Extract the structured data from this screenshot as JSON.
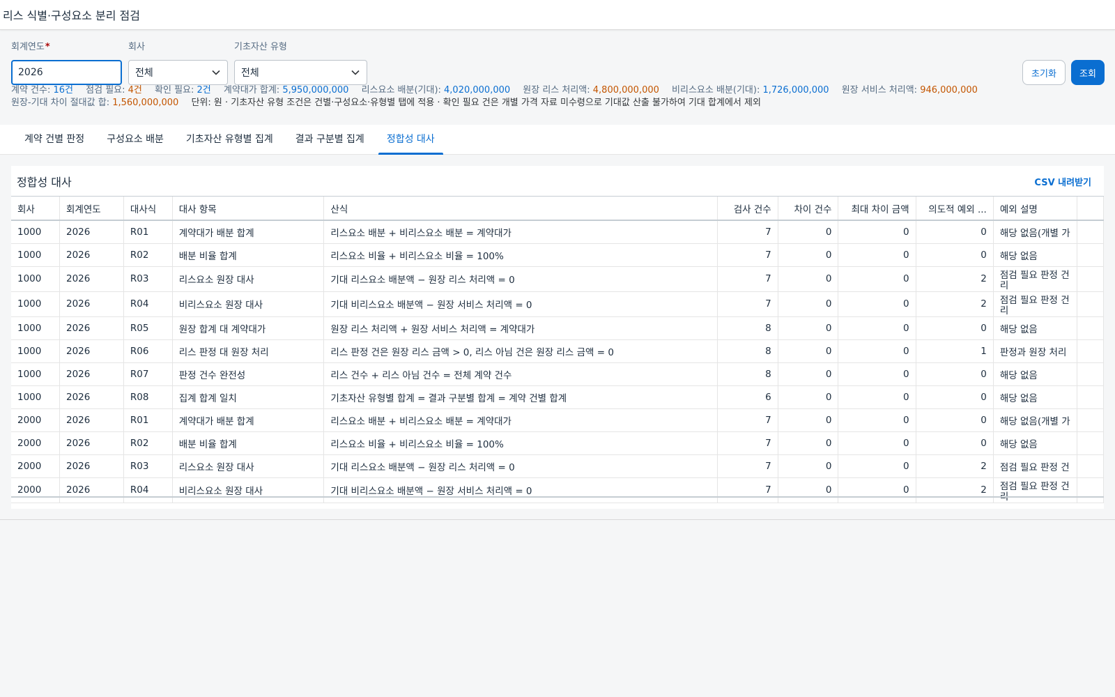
{
  "header": {
    "title": "리스 식별·구성요소 분리 점검"
  },
  "filters": {
    "fiscal_year": {
      "label": "회계연도",
      "required_mark": "*",
      "value": "2026"
    },
    "company": {
      "label": "회사",
      "value": "전체"
    },
    "asset_type": {
      "label": "기초자산 유형",
      "value": "전체"
    }
  },
  "buttons": {
    "reset": "초기화",
    "search": "조회"
  },
  "stats": {
    "contract_count": {
      "label": "계약 건수: ",
      "value": "16건"
    },
    "check_needed": {
      "label": "점검 필요: ",
      "value": "4건"
    },
    "confirm_needed": {
      "label": "확인 필요: ",
      "value": "2건"
    },
    "contract_total": {
      "label": "계약대가 합계: ",
      "value": "5,950,000,000"
    },
    "lease_alloc": {
      "label": "리스요소 배분(기대): ",
      "value": "4,020,000,000"
    },
    "ledger_lease": {
      "label": "원장 리스 처리액: ",
      "value": "4,800,000,000"
    },
    "nonlease_alloc": {
      "label": "비리스요소 배분(기대): ",
      "value": "1,726,000,000"
    },
    "ledger_service": {
      "label": "원장 서비스 처리액: ",
      "value": "946,000,000"
    },
    "abs_diff": {
      "label": "원장-기대 차이 절대값 합: ",
      "value": "1,560,000,000"
    },
    "note": "단위: 원 · 기초자산 유형 조건은 건별·구성요소·유형별 탭에 적용 · 확인 필요 건은 개별 가격 자료 미수령으로 기대값 산출 불가하여 기대 합계에서 제외"
  },
  "tabs": [
    {
      "label": "계약 건별 판정"
    },
    {
      "label": "구성요소 배분"
    },
    {
      "label": "기초자산 유형별 집계"
    },
    {
      "label": "결과 구분별 집계"
    },
    {
      "label": "정합성 대사"
    }
  ],
  "panel": {
    "title": "정합성 대사",
    "csv": "CSV 내려받기"
  },
  "table": {
    "columns": [
      "회사",
      "회계연도",
      "대사식",
      "대사 항목",
      "산식",
      "검사 건수",
      "차이 건수",
      "최대 차이 금액",
      "의도적 예외 ...",
      "예외 설명"
    ],
    "rows": [
      [
        "1000",
        "2026",
        "R01",
        "계약대가 배분 합계",
        "리스요소 배분 + 비리스요소 배분 = 계약대가",
        "7",
        "0",
        "0",
        "0",
        "해당 없음(개별 가"
      ],
      [
        "1000",
        "2026",
        "R02",
        "배분 비율 합계",
        "리스요소 비율 + 비리스요소 비율 = 100%",
        "7",
        "0",
        "0",
        "0",
        "해당 없음"
      ],
      [
        "1000",
        "2026",
        "R03",
        "리스요소 원장 대사",
        "기대 리스요소 배분액 − 원장 리스 처리액 = 0",
        "7",
        "0",
        "0",
        "2",
        "점검 필요 판정 건 리"
      ],
      [
        "1000",
        "2026",
        "R04",
        "비리스요소 원장 대사",
        "기대 비리스요소 배분액 − 원장 서비스 처리액 = 0",
        "7",
        "0",
        "0",
        "2",
        "점검 필요 판정 건 리"
      ],
      [
        "1000",
        "2026",
        "R05",
        "원장 합계 대 계약대가",
        "원장 리스 처리액 + 원장 서비스 처리액 = 계약대가",
        "8",
        "0",
        "0",
        "0",
        "해당 없음"
      ],
      [
        "1000",
        "2026",
        "R06",
        "리스 판정 대 원장 처리",
        "리스 판정 건은 원장 리스 금액 > 0, 리스 아님 건은 원장 리스 금액 = 0",
        "8",
        "0",
        "0",
        "1",
        "판정과 원장 처리"
      ],
      [
        "1000",
        "2026",
        "R07",
        "판정 건수 완전성",
        "리스 건수 + 리스 아님 건수 = 전체 계약 건수",
        "8",
        "0",
        "0",
        "0",
        "해당 없음"
      ],
      [
        "1000",
        "2026",
        "R08",
        "집계 합계 일치",
        "기초자산 유형별 합계 = 결과 구분별 합계 = 계약 건별 합계",
        "6",
        "0",
        "0",
        "0",
        "해당 없음"
      ],
      [
        "2000",
        "2026",
        "R01",
        "계약대가 배분 합계",
        "리스요소 배분 + 비리스요소 배분 = 계약대가",
        "7",
        "0",
        "0",
        "0",
        "해당 없음(개별 가"
      ],
      [
        "2000",
        "2026",
        "R02",
        "배분 비율 합계",
        "리스요소 비율 + 비리스요소 비율 = 100%",
        "7",
        "0",
        "0",
        "0",
        "해당 없음"
      ],
      [
        "2000",
        "2026",
        "R03",
        "리스요소 원장 대사",
        "기대 리스요소 배분액 − 원장 리스 처리액 = 0",
        "7",
        "0",
        "0",
        "2",
        "점검 필요 판정 건"
      ],
      [
        "2000",
        "2026",
        "R04",
        "비리스요소 원장 대사",
        "기대 비리스요소 배분액 − 원장 서비스 처리액 = 0",
        "7",
        "0",
        "0",
        "2",
        "점검 필요 판정 건 리"
      ]
    ]
  },
  "colors": {
    "accent": "#0a6ed1",
    "warn": "#c35500",
    "required": "#aa0808"
  },
  "icons": {
    "select_arrow": "chevron-down-icon"
  }
}
